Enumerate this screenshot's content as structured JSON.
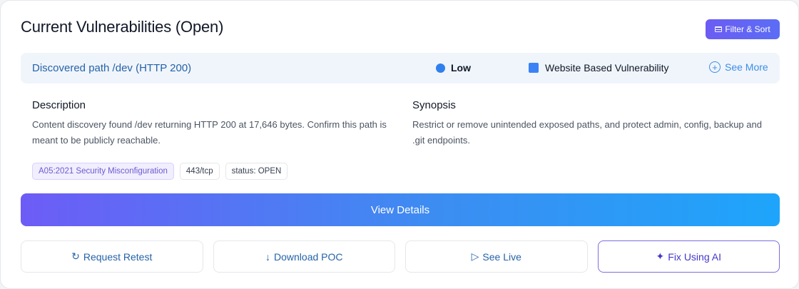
{
  "header": {
    "title": "Current Vulnerabilities (Open)",
    "filter_label": "Filter & Sort",
    "filter_icon": "▤"
  },
  "vulnerability": {
    "name": "Discovered path /dev (HTTP 200)",
    "severity": "Low",
    "severity_color": "#2f80ed",
    "type": "Website Based Vulnerability",
    "type_color": "#3b82f6",
    "see_more_icon": "+",
    "see_more": "See More",
    "description_title": "Description",
    "description": "Content discovery found /dev returning HTTP 200 at 17,646 bytes. Confirm this path is meant to be publicly reachable.",
    "synopsis_title": "Synopsis",
    "synopsis": "Restrict or remove unintended exposed paths, and protect admin, config, backup and .git endpoints.",
    "tags": [
      "A05:2021 Security Misconfiguration",
      "443/tcp",
      "status: OPEN"
    ]
  },
  "actions": {
    "view_details": "View Details",
    "retest_icon": "↻",
    "retest": "Request Retest",
    "download_icon": "↓",
    "download": "Download POC",
    "live_icon": "▷",
    "live": "See Live",
    "ai_icon": "✦",
    "ai": "Fix Using AI"
  },
  "colors": {
    "accent": "#5b6df5",
    "link": "#2563a8",
    "gradient_start": "#6d5cf6",
    "gradient_end": "#1ea5fb"
  }
}
